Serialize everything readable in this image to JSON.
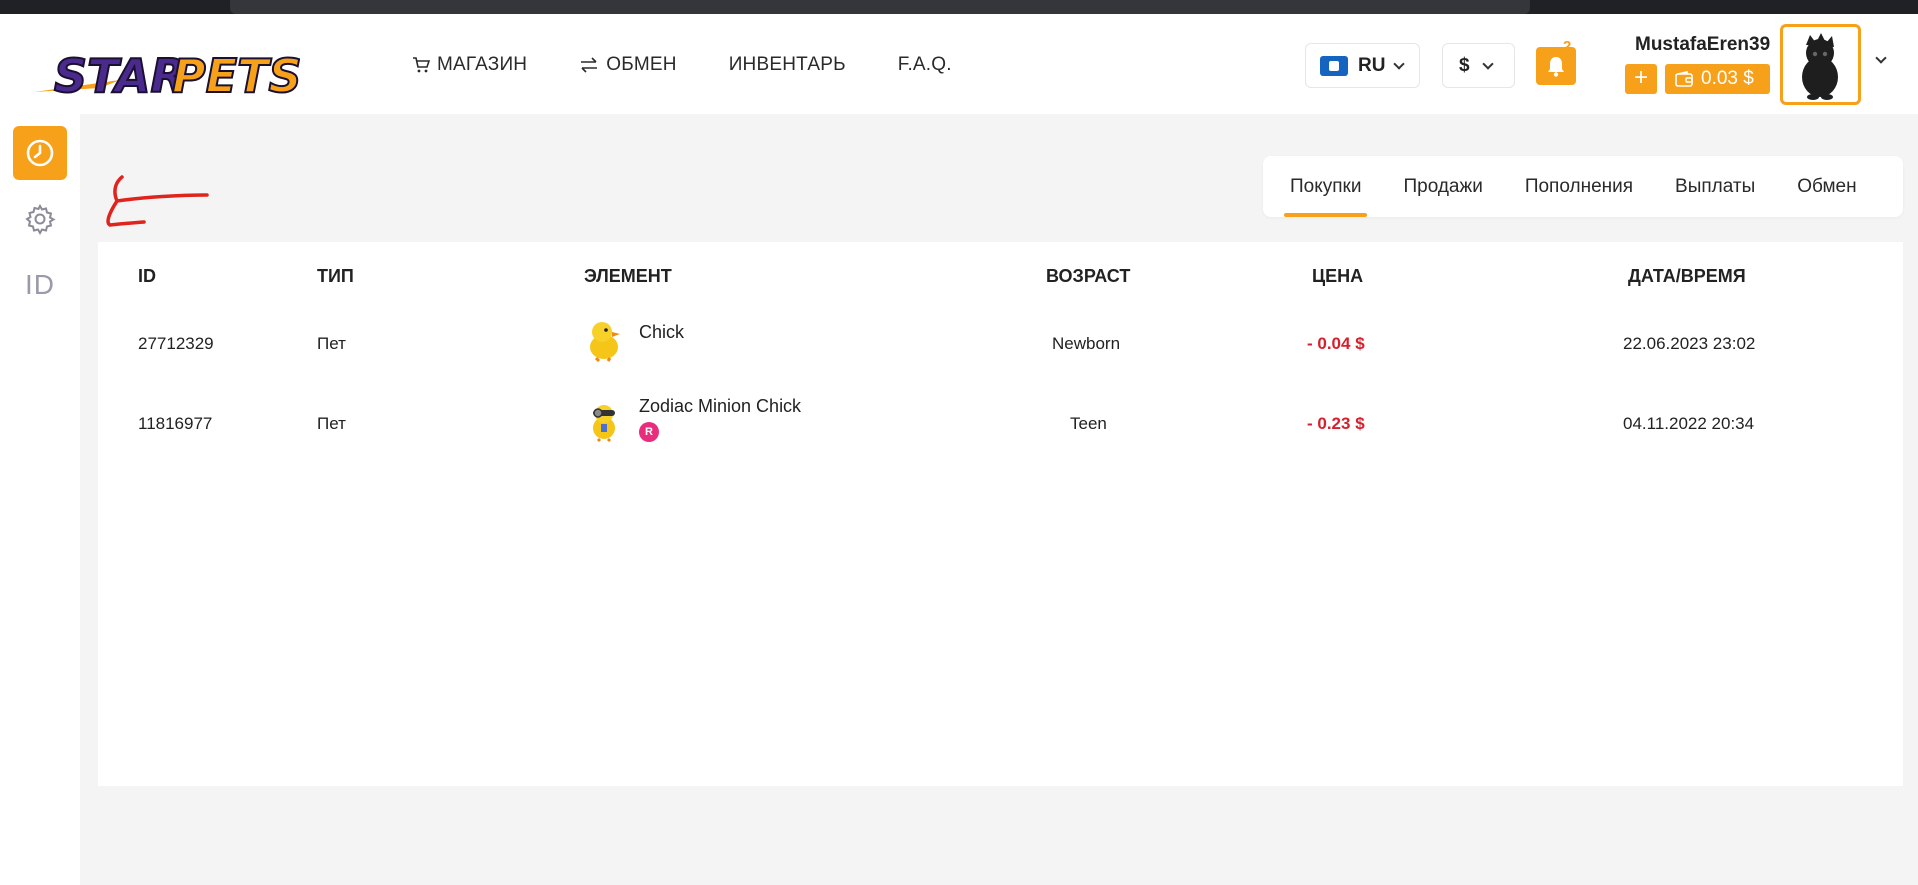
{
  "brand": {
    "logo_text": "STARPETS"
  },
  "nav": [
    {
      "label": "МАГАЗИН",
      "icon": "cart-icon"
    },
    {
      "label": "ОБМЕН",
      "icon": "swap-icon"
    },
    {
      "label": "ИНВЕНТАРЬ"
    },
    {
      "label": "F.A.Q."
    }
  ],
  "header": {
    "language": "RU",
    "currency": "$",
    "notifications_count": "2",
    "username": "MustafaEren39",
    "add_funds_label": "+",
    "balance": "0.03 $"
  },
  "sidebar": {
    "id_label": "ID"
  },
  "tabs": [
    "Покупки",
    "Продажи",
    "Пополнения",
    "Выплаты",
    "Обмен"
  ],
  "active_tab": "Покупки",
  "table": {
    "headers": {
      "id": "ID",
      "type": "ТИП",
      "item": "ЭЛЕМЕНТ",
      "age": "ВОЗРАСТ",
      "price": "ЦЕНА",
      "datetime": "ДАТА/ВРЕМЯ"
    },
    "rows": [
      {
        "id": "27712329",
        "type": "Пет",
        "item": "Chick",
        "badge": "",
        "age": "Newborn",
        "price": "- 0.04 $",
        "datetime": "22.06.2023 23:02"
      },
      {
        "id": "11816977",
        "type": "Пет",
        "item": "Zodiac Minion Chick",
        "badge": "R",
        "age": "Teen",
        "price": "- 0.23 $",
        "datetime": "04.11.2022 20:34"
      }
    ]
  },
  "colors": {
    "accent": "#f7a11a",
    "price_negative": "#d6202e",
    "badge_r": "#ea2c7c",
    "annotation": "#e0231c"
  }
}
